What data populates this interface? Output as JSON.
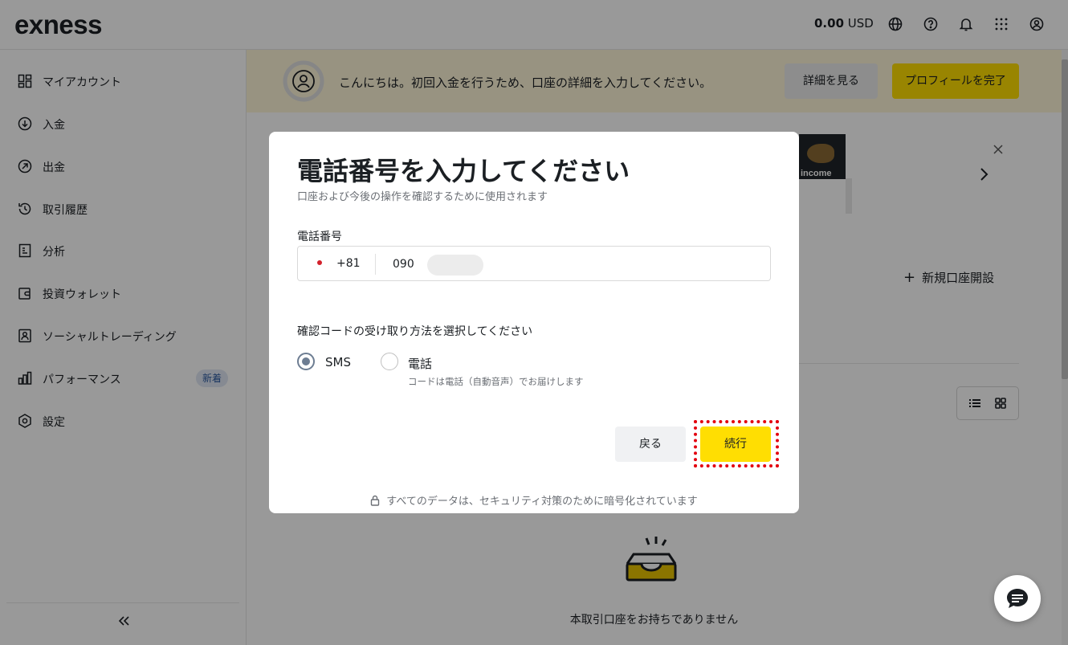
{
  "header": {
    "logo": "exness",
    "balance_amount": "0.00",
    "balance_currency": "USD",
    "icons": [
      "globe-icon",
      "help-icon",
      "bell-icon",
      "apps-grid-icon",
      "account-icon"
    ]
  },
  "sidebar": {
    "items": [
      {
        "label": "マイアカウント",
        "icon": "grid-icon"
      },
      {
        "label": "入金",
        "icon": "deposit-icon"
      },
      {
        "label": "出金",
        "icon": "withdraw-icon"
      },
      {
        "label": "取引履歴",
        "icon": "history-icon"
      },
      {
        "label": "分析",
        "icon": "analytics-icon"
      },
      {
        "label": "投資ウォレット",
        "icon": "wallet-icon"
      },
      {
        "label": "ソーシャルトレーディング",
        "icon": "social-trading-icon"
      },
      {
        "label": "パフォーマンス",
        "icon": "bar-chart-icon",
        "badge": "新着"
      },
      {
        "label": "設定",
        "icon": "settings-icon"
      }
    ],
    "collapse_icon": "double-chevron-left-icon"
  },
  "banner": {
    "text": "こんにちは。初回入金を行うため、口座の詳細を入力してください。",
    "details_button": "詳細を見る",
    "profile_button": "プロフィールを完了"
  },
  "promo": {
    "image_text": "income"
  },
  "main": {
    "new_account": "新規口座開設",
    "empty_text": "本取引口座をお持ちでありません"
  },
  "modal": {
    "title": "電話番号を入力してください",
    "subtitle": "口座および今後の操作を確認するために使用されます",
    "phone_label": "電話番号",
    "country_code": "+81",
    "phone_prefix": "090",
    "method_label": "確認コードの受け取り方法を選択してください",
    "option_sms": "SMS",
    "option_call": "電話",
    "call_hint": "コードは電話（自動音声）でお届けします",
    "back_button": "戻る",
    "continue_button": "続行",
    "footer": "すべてのデータは、セキュリティ対策のために暗号化されています"
  },
  "colors": {
    "accent_yellow": "#ffde02",
    "highlight_red": "#e3000f",
    "banner_bg": "#fdf6d8"
  }
}
